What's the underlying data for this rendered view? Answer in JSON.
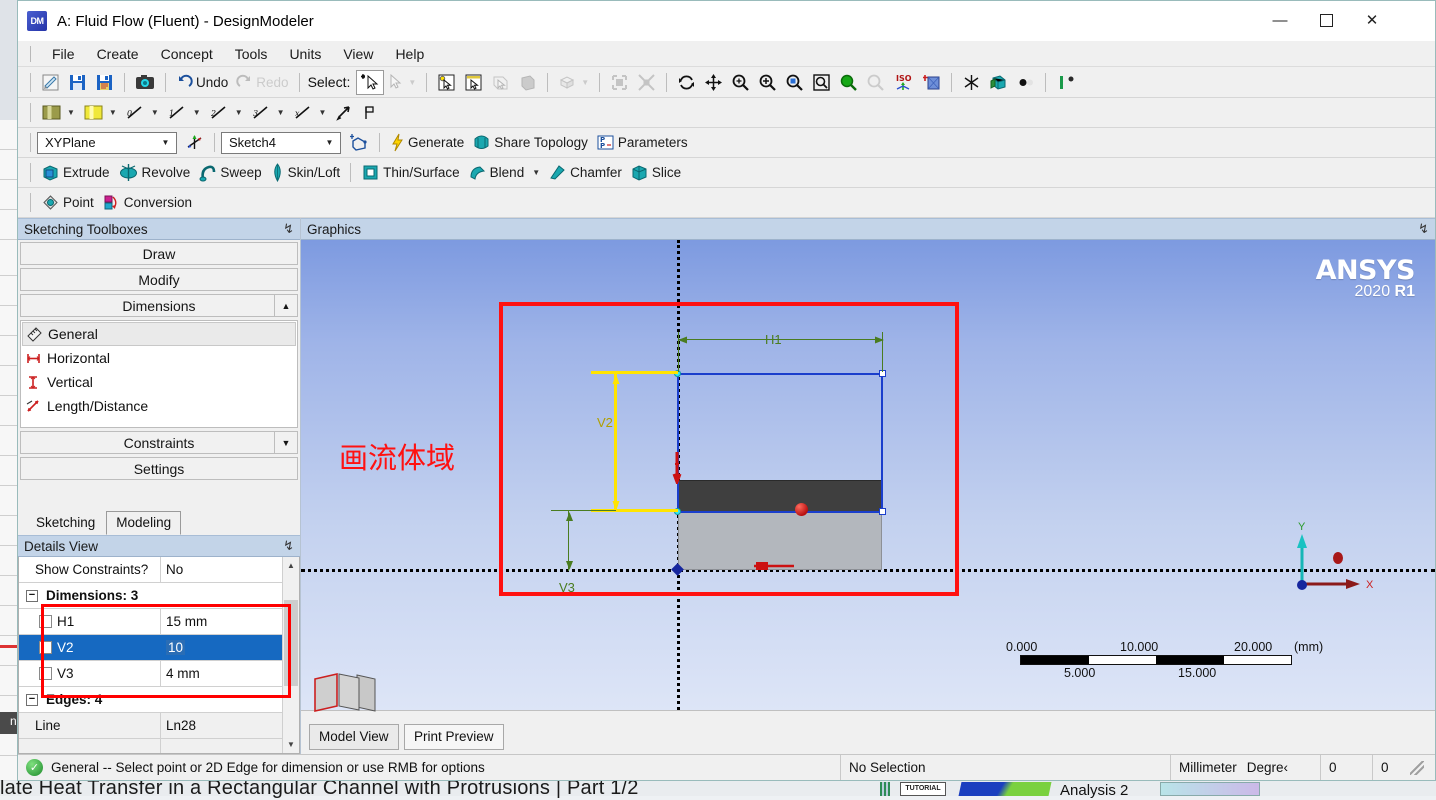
{
  "background": {
    "title_text": "late Heat Transfer in a Rectangular Channel with Protrusions | Part 1/2",
    "tutorial_badge": "TUTORIAL",
    "analysis_text": "Analysis 2"
  },
  "titlebar": {
    "app_icon": "DM",
    "title": "A: Fluid Flow (Fluent) - DesignModeler",
    "minimize": "—",
    "maximize": "☐",
    "close": "✕"
  },
  "menubar": {
    "items": [
      "File",
      "Create",
      "Concept",
      "Tools",
      "Units",
      "View",
      "Help"
    ]
  },
  "toolbar": {
    "undo_label": "Undo",
    "redo_label": "Redo",
    "select_label": "Select:",
    "plane_value": "XYPlane",
    "sketch_value": "Sketch4",
    "generate_label": "Generate",
    "share_topology_label": "Share Topology",
    "parameters_label": "Parameters",
    "extrude_label": "Extrude",
    "revolve_label": "Revolve",
    "sweep_label": "Sweep",
    "skin_loft_label": "Skin/Loft",
    "thin_surface_label": "Thin/Surface",
    "blend_label": "Blend",
    "chamfer_label": "Chamfer",
    "slice_label": "Slice",
    "point_label": "Point",
    "conversion_label": "Conversion"
  },
  "sketching_panel": {
    "title": "Sketching Toolboxes",
    "pin": "↯",
    "accordions": [
      "Draw",
      "Modify",
      "Dimensions"
    ],
    "dimension_tools": [
      "General",
      "Horizontal",
      "Vertical",
      "Length/Distance"
    ],
    "accordions_after": [
      "Constraints",
      "Settings"
    ],
    "tabs": [
      {
        "label": "Sketching",
        "active": false
      },
      {
        "label": "Modeling",
        "active": true
      }
    ]
  },
  "details_view": {
    "title": "Details View",
    "pin": "↯",
    "rows": [
      {
        "type": "kv",
        "label": "Show Constraints?",
        "value": "No"
      },
      {
        "type": "section",
        "label": "Dimensions: 3"
      },
      {
        "type": "dim",
        "label": "H1",
        "value": "15 mm",
        "selected": false
      },
      {
        "type": "dim",
        "label": "V2",
        "value": "10",
        "selected": true
      },
      {
        "type": "dim",
        "label": "V3",
        "value": "4 mm",
        "selected": false
      },
      {
        "type": "section",
        "label": "Edges: 4"
      },
      {
        "type": "kv_grey",
        "label": "Line",
        "value": "Ln28"
      }
    ]
  },
  "graphics": {
    "title": "Graphics",
    "pin": "↯",
    "logo_name": "ANSYS",
    "logo_version_year": "2020 ",
    "logo_version_rel": "R1",
    "annotation_text": "画流体域",
    "dimension_labels": {
      "h1": "H1",
      "v2": "V2",
      "v3": "V3"
    },
    "ruler": {
      "top_ticks": [
        "0.000",
        "10.000",
        "20.000"
      ],
      "units": "(mm)",
      "bottom_ticks": [
        "5.000",
        "15.000"
      ]
    },
    "triad": {
      "x": "X",
      "y": "Y"
    },
    "tabs": [
      {
        "label": "Model View",
        "active": true
      },
      {
        "label": "Print Preview",
        "active": false
      }
    ]
  },
  "statusbar": {
    "message": "General -- Select point or 2D Edge for dimension or use RMB for options",
    "selection": "No Selection",
    "unit_length": "Millimeter",
    "unit_angle": "Degre‹",
    "num1": "0",
    "num2": "0"
  }
}
